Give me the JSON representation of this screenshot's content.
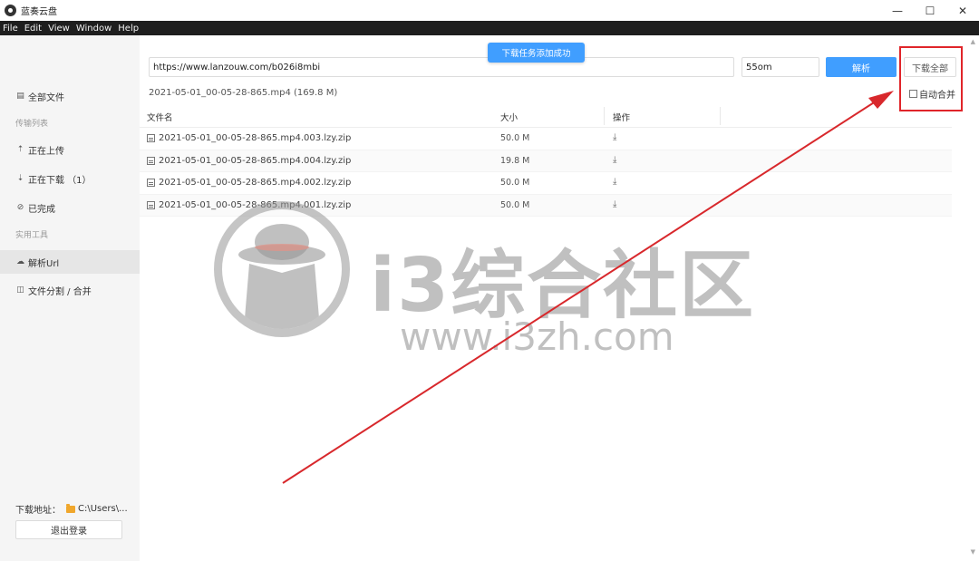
{
  "window": {
    "title": "蓝奏云盘",
    "min": "—",
    "max": "☐",
    "close": "✕"
  },
  "menu": [
    "File",
    "Edit",
    "View",
    "Window",
    "Help"
  ],
  "sidebar": {
    "all_files": "全部文件",
    "transfer_section": "传输列表",
    "uploading": "正在上传",
    "downloading": "正在下载 （1）",
    "completed": "已完成",
    "tools_section": "实用工具",
    "parse_url": "解析Url",
    "split_merge": "文件分割 / 合并",
    "download_path_label": "下载地址：",
    "download_path_value": "C:\\Users\\...",
    "logout": "退出登录"
  },
  "toolbar": {
    "url_value": "https://www.lanzouw.com/b026i8mbi",
    "speed_value": "55om",
    "parse_label": "解析",
    "download_all_label": "下载全部",
    "auto_merge_label": "自动合并"
  },
  "toast": "下载任务添加成功",
  "file_info": "2021-05-01_00-05-28-865.mp4  (169.8 M)",
  "table": {
    "headers": {
      "name": "文件名",
      "size": "大小",
      "op": "操作"
    },
    "rows": [
      {
        "name": "2021-05-01_00-05-28-865.mp4.003.lzy.zip",
        "size": "50.0 M"
      },
      {
        "name": "2021-05-01_00-05-28-865.mp4.004.lzy.zip",
        "size": "19.8 M"
      },
      {
        "name": "2021-05-01_00-05-28-865.mp4.002.lzy.zip",
        "size": "50.0 M"
      },
      {
        "name": "2021-05-01_00-05-28-865.mp4.001.lzy.zip",
        "size": "50.0 M"
      }
    ]
  },
  "watermark": {
    "title": "i3综合社区",
    "url": "www.i3zh.com"
  },
  "colors": {
    "accent": "#409eff",
    "annotation": "#e0252a",
    "menubar": "#1e1e1e"
  },
  "icons": {
    "download": "download-icon",
    "file": "file-icon",
    "folder": "folder-icon"
  }
}
